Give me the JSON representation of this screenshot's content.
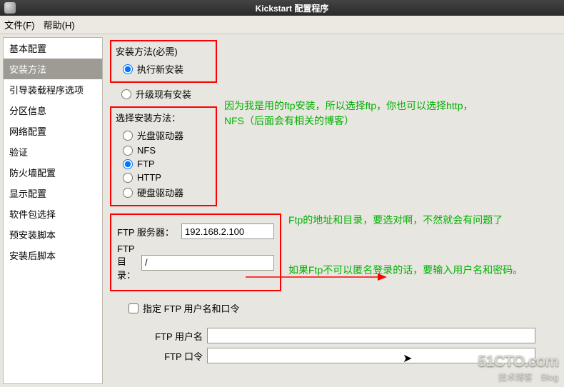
{
  "titlebar": {
    "title": "Kickstart 配置程序"
  },
  "menubar": {
    "file": "文件(F)",
    "help": "帮助(H)"
  },
  "sidebar": {
    "items": [
      {
        "label": "基本配置"
      },
      {
        "label": "安装方法"
      },
      {
        "label": "引导装载程序选项"
      },
      {
        "label": "分区信息"
      },
      {
        "label": "网络配置"
      },
      {
        "label": "验证"
      },
      {
        "label": "防火墙配置"
      },
      {
        "label": "显示配置"
      },
      {
        "label": "软件包选择"
      },
      {
        "label": "预安装脚本"
      },
      {
        "label": "安装后脚本"
      }
    ],
    "selected_index": 1
  },
  "install_method": {
    "group_label": "安装方法(必需)",
    "new_install": "执行新安装",
    "upgrade": "升级现有安装"
  },
  "choose_method": {
    "group_label": "选择安装方法：",
    "cdrom": "光盘驱动器",
    "nfs": "NFS",
    "ftp": "FTP",
    "http": "HTTP",
    "hdd": "硬盘驱动器"
  },
  "ftp": {
    "server_label": "FTP 服务器：",
    "server_value": "192.168.2.100",
    "dir_label": "FTP 目录：",
    "dir_value": "/",
    "specify_creds": "指定 FTP 用户名和口令",
    "user_label": "FTP 用户名",
    "user_value": "",
    "pass_label": "FTP 口令",
    "pass_value": ""
  },
  "annotations": {
    "note1": "因为我是用的ftp安装，所以选择ftp，你也可以选择http，NFS（后面会有相关的博客）",
    "note2": "Ftp的地址和目录，要选对啊，不然就会有问题了",
    "note3": "如果Ftp不可以匿名登录的话，要输入用户名和密码。"
  },
  "watermark": {
    "big": "51CTO.com",
    "small": "技术博客　Blog"
  }
}
